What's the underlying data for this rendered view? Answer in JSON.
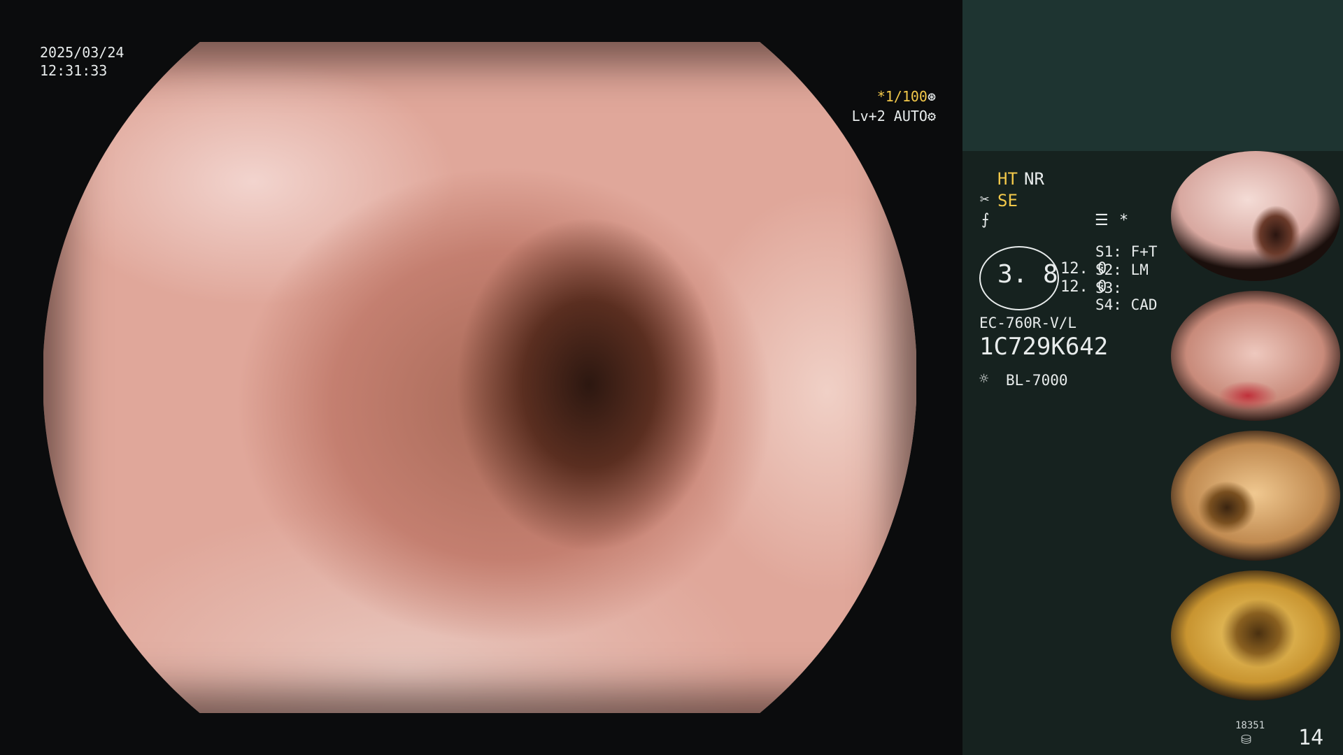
{
  "osd": {
    "date": "2025/03/24",
    "time": "12:31:33",
    "shutter": "*1/100",
    "level": "Lv+2 AUTO"
  },
  "info": {
    "ht": "HT",
    "nr": "NR",
    "se": "SE",
    "circle_value": "3. 8",
    "val1": "12. 0",
    "val2": "12. 0",
    "s1": "S1: F+T",
    "s2": "S2: LM",
    "s3": "S3:",
    "s4": "S4: CAD",
    "scope_model": "EC-760R-V/L",
    "scope_serial": "1C729K642",
    "light_source": "BL-7000"
  },
  "footer": {
    "count_small": "18351",
    "count_big": "14"
  },
  "icons": [
    "aperture-icon",
    "gear-icon",
    "scissors-icon",
    "fork-icon",
    "menu-icon",
    "sun-icon",
    "database-icon"
  ],
  "colors": {
    "accent_yellow": "#f2c84a",
    "panel_bg": "#16221f",
    "panel_top_bg": "#1e3431"
  }
}
